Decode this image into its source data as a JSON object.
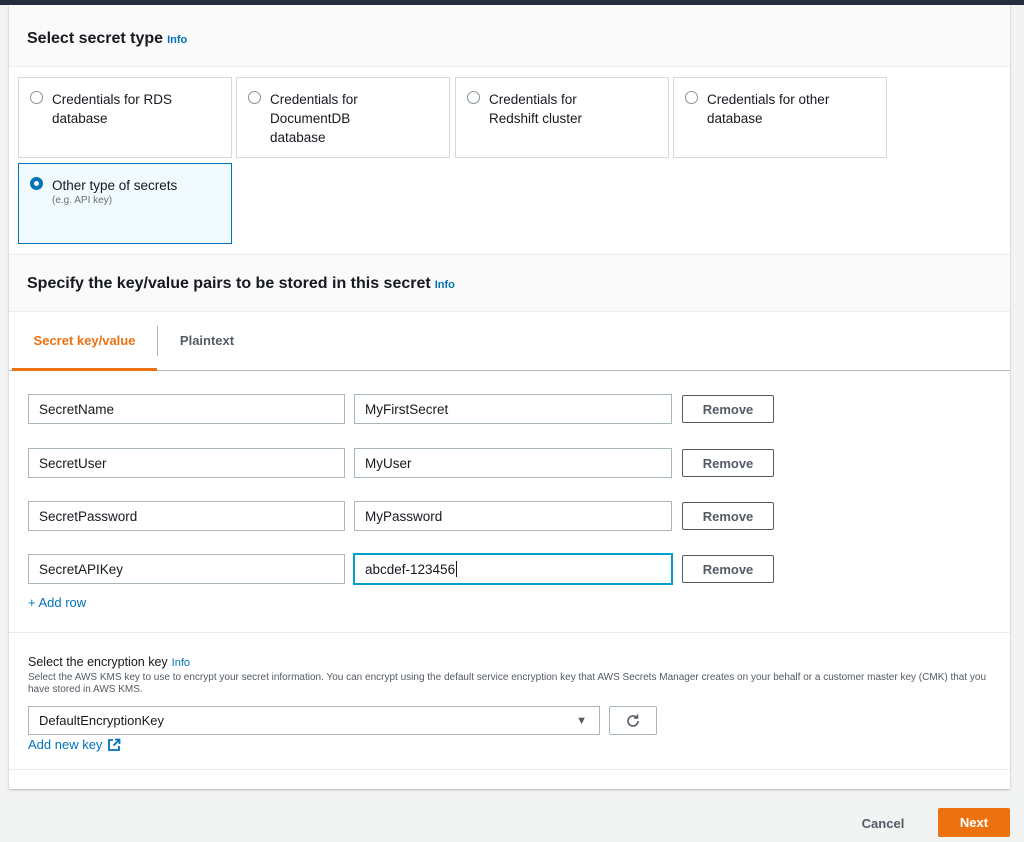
{
  "secret_type": {
    "title": "Select secret type",
    "info": "Info",
    "options": [
      {
        "label": "Credentials for RDS database",
        "desc": ""
      },
      {
        "label": "Credentials for DocumentDB database",
        "desc": ""
      },
      {
        "label": "Credentials for Redshift cluster",
        "desc": ""
      },
      {
        "label": "Credentials for other database",
        "desc": ""
      },
      {
        "label": "Other type of secrets",
        "desc": "(e.g. API key)"
      }
    ],
    "selected": "Other type of secrets"
  },
  "kv_section": {
    "title": "Specify the key/value pairs to be stored in this secret",
    "info": "Info",
    "tabs": [
      "Secret key/value",
      "Plaintext"
    ],
    "active_tab": "Secret key/value",
    "rows": [
      {
        "key": "SecretName",
        "value": "MyFirstSecret",
        "remove": "Remove"
      },
      {
        "key": "SecretUser",
        "value": "MyUser",
        "remove": "Remove"
      },
      {
        "key": "SecretPassword",
        "value": "MyPassword",
        "remove": "Remove"
      },
      {
        "key": "SecretAPIKey",
        "value": "abcdef-123456",
        "remove": "Remove"
      }
    ],
    "add_row": "+ Add row"
  },
  "encryption": {
    "title": "Select the encryption key",
    "info": "Info",
    "description": "Select the AWS KMS key to use to encrypt your secret information. You can encrypt using the default service encryption key that AWS Secrets Manager creates on your behalf or a customer master key (CMK) that you have stored in AWS KMS.",
    "selected_key": "DefaultEncryptionKey",
    "add_new_key": "Add new key"
  },
  "footer": {
    "cancel": "Cancel",
    "next": "Next"
  },
  "colors": {
    "accent": "#ec7211",
    "link": "#0073bb",
    "selected_border": "#0073bb",
    "focus": "#00a1c9"
  }
}
